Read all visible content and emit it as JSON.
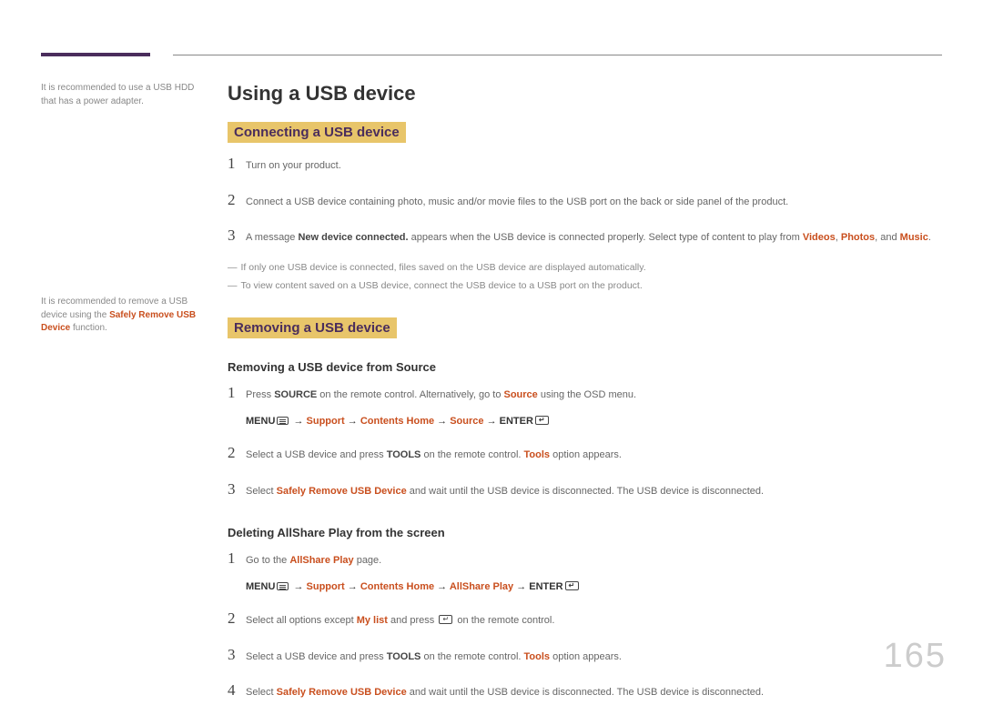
{
  "page_number": "165",
  "sidebar": {
    "note1": "It is recommended to use a USB HDD that has a power adapter.",
    "note2_pre": "It is recommended to remove a USB device using the ",
    "note2_highlight": "Safely Remove USB Device",
    "note2_post": " function."
  },
  "h1": "Using a USB device",
  "h2_connect": "Connecting a USB device",
  "connect_steps": {
    "s1": "Turn on your product.",
    "s2": "Connect a USB device containing photo, music and/or movie files to the USB port on the back or side panel of the product.",
    "s3_a": "A message ",
    "s3_bold": "New device connected.",
    "s3_b": " appears when the USB device is connected properly. Select type of content to play from ",
    "s3_v": "Videos",
    "s3_c1": ", ",
    "s3_p": "Photos",
    "s3_c2": ", and ",
    "s3_m": "Music",
    "s3_end": "."
  },
  "dash1": "If only one USB device is connected, files saved on the USB device are displayed automatically.",
  "dash2": "To view content saved on a USB device, connect the USB device to a USB port on the product.",
  "h2_remove": "Removing a USB device",
  "h3_source": "Removing a USB device from Source",
  "source_steps": {
    "s1_a": "Press ",
    "s1_bold": "SOURCE",
    "s1_b": " on the remote control. Alternatively, go to ",
    "s1_src": "Source",
    "s1_c": " using the OSD menu.",
    "path1_menu": "MENU",
    "path1_a": " → ",
    "path1_support": "Support",
    "path1_b": " → ",
    "path1_contents": "Contents Home",
    "path1_c": " → ",
    "path1_source": "Source",
    "path1_d": " → ",
    "path1_enter": "ENTER",
    "s2_a": "Select a USB device and press ",
    "s2_tools": "TOOLS",
    "s2_b": " on the remote control. ",
    "s2_tools2": "Tools",
    "s2_c": " option appears.",
    "s3_a": "Select ",
    "s3_safe": "Safely Remove USB Device",
    "s3_b": " and wait until the USB device is disconnected. The USB device is disconnected."
  },
  "h3_allshare": "Deleting AllShare Play from the screen",
  "allshare_steps": {
    "s1_a": "Go to the ",
    "s1_asp": "AllShare Play",
    "s1_b": " page.",
    "path2_menu": "MENU",
    "path2_a": " → ",
    "path2_support": "Support",
    "path2_b": " → ",
    "path2_contents": "Contents Home",
    "path2_c": " → ",
    "path2_asp": "AllShare Play",
    "path2_d": " → ",
    "path2_enter": "ENTER",
    "s2_a": "Select all options except ",
    "s2_mylist": "My list",
    "s2_b": " and press ",
    "s2_c": " on the remote control.",
    "s3_a": "Select a USB device and press ",
    "s3_tools": "TOOLS",
    "s3_b": " on the remote control. ",
    "s3_tools2": "Tools",
    "s3_c": " option appears.",
    "s4_a": "Select ",
    "s4_safe": "Safely Remove USB Device",
    "s4_b": " and wait until the USB device is disconnected. The USB device is disconnected."
  }
}
